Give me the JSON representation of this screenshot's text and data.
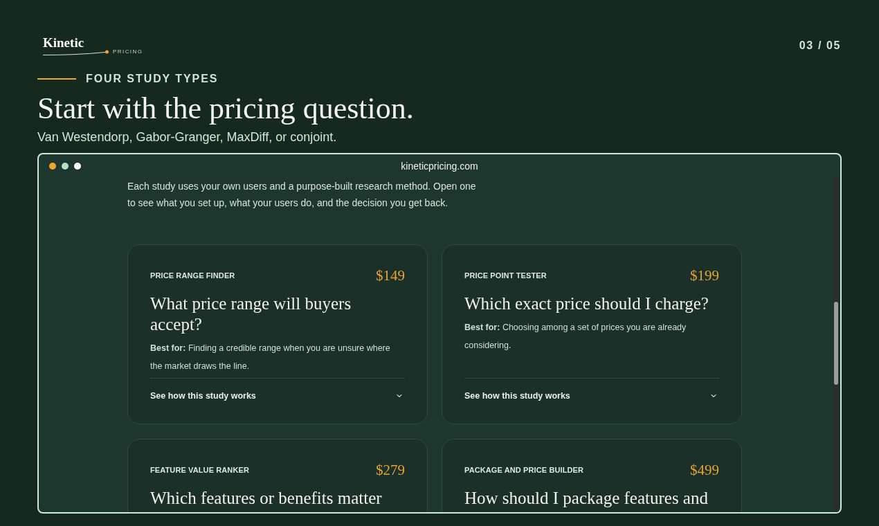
{
  "logo": {
    "wordmark": "Kinetic",
    "tagline": "PRICING"
  },
  "page_counter": "03 / 05",
  "eyebrow": "FOUR STUDY TYPES",
  "heading": "Start with the pricing question.",
  "subheading": "Van Westendorp, Gabor-Granger, MaxDiff, or conjoint.",
  "browser": {
    "url": "kineticpricing.com",
    "intro": "Each study uses your own users and a purpose-built research method. Open one to see what you set up, what your users do, and the decision you get back.",
    "cards": [
      {
        "label": "PRICE RANGE FINDER",
        "price": "$149",
        "title": "What price range will buyers accept?",
        "best_for": "**Best for:** Finding a credible range when you are unsure where the market draws the line.",
        "link": "See how this study works"
      },
      {
        "label": "PRICE POINT TESTER",
        "price": "$199",
        "title": "Which exact price should I charge?",
        "best_for": "**Best for:** Choosing among a set of prices you are already considering.",
        "link": "See how this study works"
      },
      {
        "label": "FEATURE VALUE RANKER",
        "price": "$279",
        "title": "Which features or benefits matter"
      },
      {
        "label": "PACKAGE AND PRICE BUILDER",
        "price": "$499",
        "title": "How should I package features and"
      }
    ]
  }
}
